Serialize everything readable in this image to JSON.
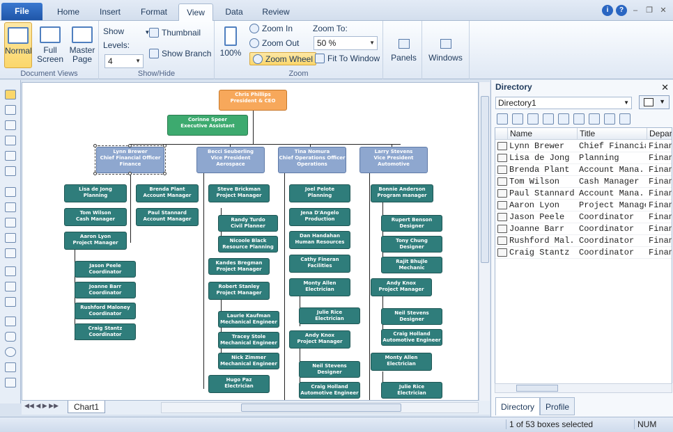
{
  "menu": {
    "file": "File",
    "tabs": [
      "Home",
      "Insert",
      "Format",
      "View",
      "Data",
      "Review"
    ],
    "active": "View"
  },
  "ribbon": {
    "doc_views": {
      "label": "Document Views",
      "normal": "Normal",
      "full_screen": "Full Screen",
      "master_page": "Master Page"
    },
    "show_hide": {
      "label": "Show/Hide",
      "show": "Show",
      "levels": "Levels:",
      "levels_value": "4",
      "thumbnail": "Thumbnail",
      "show_branch": "Show Branch"
    },
    "zoom": {
      "label": "Zoom",
      "pct": "100%",
      "zoom_in": "Zoom In",
      "zoom_out": "Zoom Out",
      "zoom_wheel": "Zoom Wheel",
      "zoom_to": "Zoom To:",
      "zoom_value": "50 %",
      "fit": "Fit To Window"
    },
    "panels": "Panels",
    "windows": "Windows"
  },
  "chart": {
    "ceo": "Chris Phillips\nPresident & CEO",
    "ea": "Corinne Speer\nExecutive Assistant",
    "vps": [
      "Lynn Brewer\nChief Financial Officer\nFinance",
      "Becci Seuberling\nVice President\nAerospace",
      "Tina Nomura\nChief Operations Officer\nOperations",
      "Larry Stevens\nVice President\nAutomotive"
    ],
    "finance": [
      "Lisa de Jong\nPlanning",
      "Brenda Plant\nAccount Manager",
      "Tom Wilson\nCash Manager",
      "Paul Stannard\nAccount Manager",
      "Aaron Lyon\nProject Manager",
      "Jason Peele\nCoordinator",
      "Joanne Barr\nCoordinator",
      "Rushford Maloney\nCoordinator",
      "Craig Stantz\nCoordinator"
    ],
    "aero": [
      "Steve Brickman\nProject Manager",
      "Randy Turdo\nCivil Planner",
      "Nicoole Black\nResource Planning",
      "Kandes Bregman\nProject Manager",
      "Robert Stanley\nProject Manager",
      "Laurie Kaufman\nMechanical Engineer",
      "Tracey Stole\nMechanical Engineer",
      "Nick Zimmer\nMechanical Engineer",
      "Hugo Paz\nElectrician"
    ],
    "ops": [
      "Joel Pelote\nPlanning",
      "Jena D'Angelo\nProduction",
      "Dan Handahan\nHuman Resources",
      "Cathy Fineran\nFacilities",
      "Monty Allen\nElectrician",
      "Julie Rice\nElectrician",
      "Andy Knox\nProject Manager",
      "Neil Stevens\nDesigner",
      "Craig Holland\nAutomotive Engineer"
    ],
    "auto": [
      "Bonnie Anderson\nProgram manager",
      "Rupert Benson\nDesigner",
      "Tony Chung\nDesigner",
      "Rajit Bhujle\nMechanic",
      "Andy Knox\nProject Manager",
      "Neil Stevens\nDesigner",
      "Craig Holland\nAutomotive Engineer",
      "Monty Allen\nElectrician",
      "Julie Rice\nElectrician"
    ]
  },
  "sheet_tab": "Chart1",
  "directory": {
    "title": "Directory",
    "selected": "Directory1",
    "headers": [
      "Name",
      "Title",
      "Depar"
    ],
    "rows": [
      [
        "Lynn  Brewer",
        "Chief Financial...",
        "Finan"
      ],
      [
        "Lisa de Jong",
        "Planning",
        "Finan"
      ],
      [
        "Brenda  Plant",
        "Account Mana...",
        "Finan"
      ],
      [
        "Tom Wilson",
        "Cash Manager",
        "Finan"
      ],
      [
        "Paul  Stannard",
        "Account Mana...",
        "Finan"
      ],
      [
        "Aaron  Lyon",
        "Project Manager",
        "Finan"
      ],
      [
        "Jason  Peele",
        "Coordinator",
        "Finan"
      ],
      [
        "Joanne  Barr",
        "Coordinator",
        "Finan"
      ],
      [
        "Rushford  Mal...",
        "Coordinator",
        "Finan"
      ],
      [
        "Craig  Stantz",
        "Coordinator",
        "Finan"
      ]
    ],
    "tabs": [
      "Directory",
      "Profile"
    ]
  },
  "status": {
    "selection": "1 of 53 boxes selected",
    "num": "NUM"
  }
}
